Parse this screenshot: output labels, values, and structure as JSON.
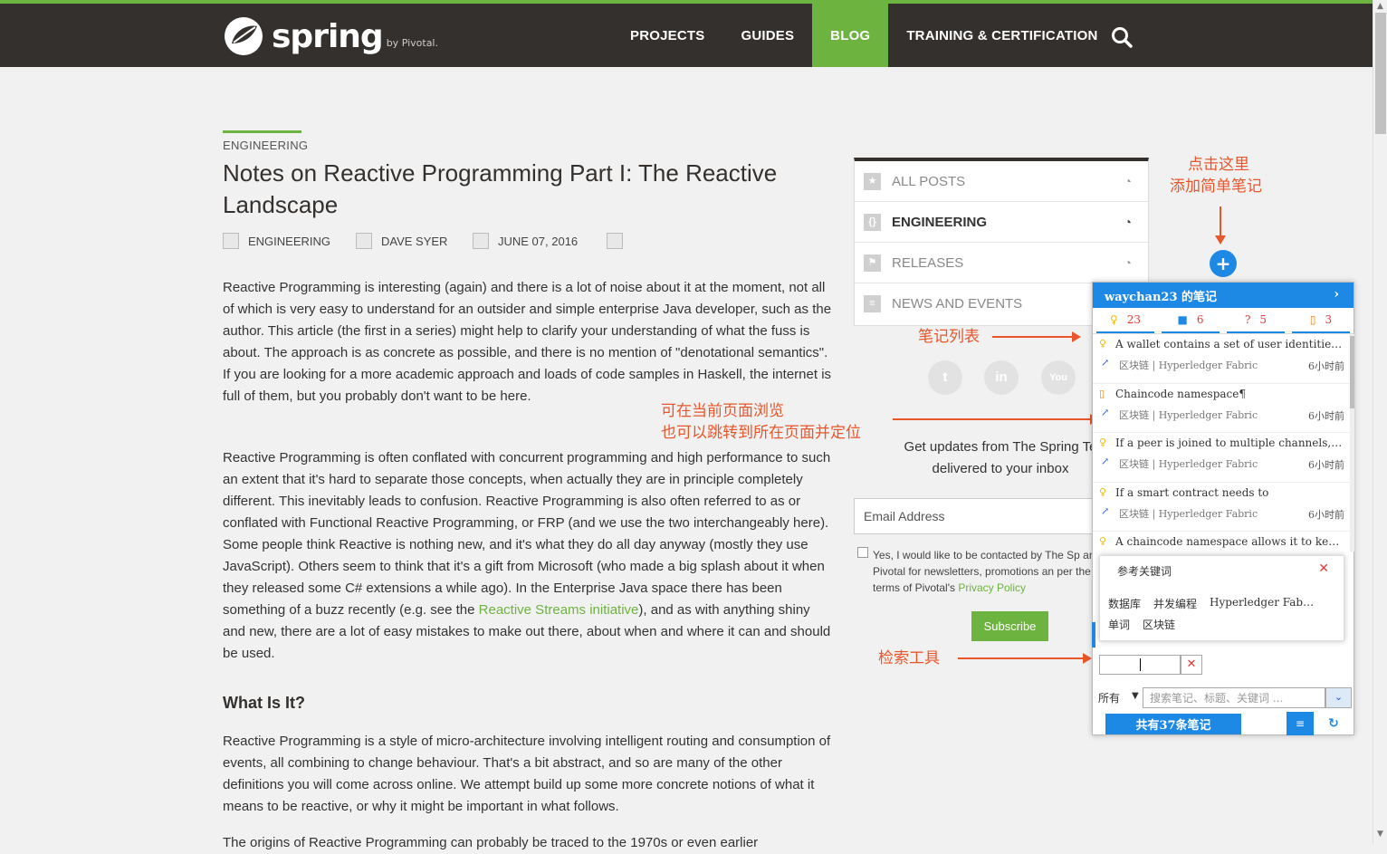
{
  "header": {
    "logo_word": "spring",
    "logo_by": "by Pivotal.",
    "nav": [
      "PROJECTS",
      "GUIDES",
      "BLOG",
      "TRAINING & CERTIFICATION"
    ],
    "active_nav": "BLOG",
    "search_icon": "search-icon"
  },
  "article": {
    "category": "ENGINEERING",
    "title": "Notes on Reactive Programming Part I: The Reactive Landscape",
    "meta": {
      "category": "ENGINEERING",
      "author": "DAVE SYER",
      "date": "JUNE 07, 2016"
    },
    "p1": "Reactive Programming is interesting (again) and there is a lot of noise about it at the moment, not all of which is very easy to understand for an outsider and simple enterprise Java developer, such as the author. This article (the first in a series) might help to clarify your understanding of what the fuss is about. The approach is as concrete as possible, and there is no mention of \"denotational semantics\". If you are looking for a more academic approach and loads of code samples in Haskell, the internet is full of them, but you probably don't want to be here.",
    "p2_before": "Reactive Programming is often conflated with concurrent programming and high performance to such an extent that it's hard to separate those concepts, when actually they are in principle completely different. This inevitably leads to confusion. Reactive Programming is also often referred to as or conflated with Functional Reactive Programming, or FRP (and we use the two interchangeably here). Some people think Reactive is nothing new, and it's what they do all day anyway (mostly they use JavaScript). Others seem to think that it's a gift from Microsoft (who made a big splash about it when they released some C# extensions a while ago). In the Enterprise Java space there has been something of a buzz recently (e.g. see the ",
    "p2_link": "Reactive Streams initiative",
    "p2_after": "), and as with anything shiny and new, there are a lot of easy mistakes to make out there, about when and where it can and should be used.",
    "h2": "What Is It?",
    "p3": "Reactive Programming is a style of micro-architecture involving intelligent routing and consumption of events, all combining to change behaviour. That's a bit abstract, and so are many of the other definitions you will come across online. We attempt build up some more concrete notions of what it means to be reactive, or why it might be important in what follows.",
    "p4": "The origins of Reactive Programming can probably be traced to the 1970s or even earlier"
  },
  "sidebar": {
    "items": [
      {
        "label": "ALL POSTS",
        "bold": false
      },
      {
        "label": "ENGINEERING",
        "bold": true
      },
      {
        "label": "RELEASES",
        "bold": false
      },
      {
        "label": "NEWS AND EVENTS",
        "bold": false
      }
    ],
    "social": [
      "twitter-icon",
      "linkedin-icon",
      "youtube-icon"
    ],
    "updates_line1": "Get updates from The Spring Te",
    "updates_line2": "delivered to your inbox",
    "email_placeholder": "Email Address",
    "consent_before": "Yes, I would like to be contacted by The Sp and Pivotal for newsletters, promotions an per the terms of Pivotal's ",
    "consent_link": "Privacy Policy",
    "subscribe": "Subscribe"
  },
  "annotations": {
    "add_note_line1": "点击这里",
    "add_note_line2": "添加简单笔记",
    "note_list": "笔记列表",
    "browse_line1": "可在当前页面浏览",
    "browse_line2": "也可以跳转到所在页面并定位",
    "search_tool": "检索工具"
  },
  "panel": {
    "title": "waychan23 的笔记",
    "stats": [
      {
        "icon": "bulb-icon",
        "count": "23"
      },
      {
        "icon": "chat-icon",
        "count": "6"
      },
      {
        "icon": "question-icon",
        "count": "5"
      },
      {
        "icon": "clipboard-icon",
        "count": "3"
      }
    ],
    "notes": [
      {
        "title": "A wallet contains a set of user identitie…",
        "tags": "区块链 | Hyperledger Fabric",
        "time": "6小时前",
        "icon": "bulb"
      },
      {
        "title": "Chaincode namespace¶",
        "tags": "区块链 | Hyperledger Fabric",
        "time": "6小时前",
        "icon": "clip"
      },
      {
        "title": "If a peer is joined to multiple channels, …",
        "tags": "区块链 | Hyperledger Fabric",
        "time": "6小时前",
        "icon": "bulb"
      },
      {
        "title": "If a smart contract needs to",
        "tags": "区块链 | Hyperledger Fabric",
        "time": "6小时前",
        "icon": "bulb"
      },
      {
        "title": "A chaincode namespace allows it to ke…",
        "tags": "",
        "time": "",
        "icon": "bulb"
      }
    ],
    "kw_title": "参考关键词",
    "kw_row1": [
      "数据库",
      "并发编程",
      "Hyperledger Fab…"
    ],
    "kw_row2": [
      "单词",
      "区块链"
    ],
    "scope": "所有",
    "search_placeholder": "搜索笔记、标题、关键词 ...",
    "count_label": "共有37条笔记"
  },
  "colors": {
    "spring_green": "#6db33f",
    "nav_dark": "#34302d",
    "panel_blue": "#1e88e5",
    "annotation": "#e8562a"
  }
}
